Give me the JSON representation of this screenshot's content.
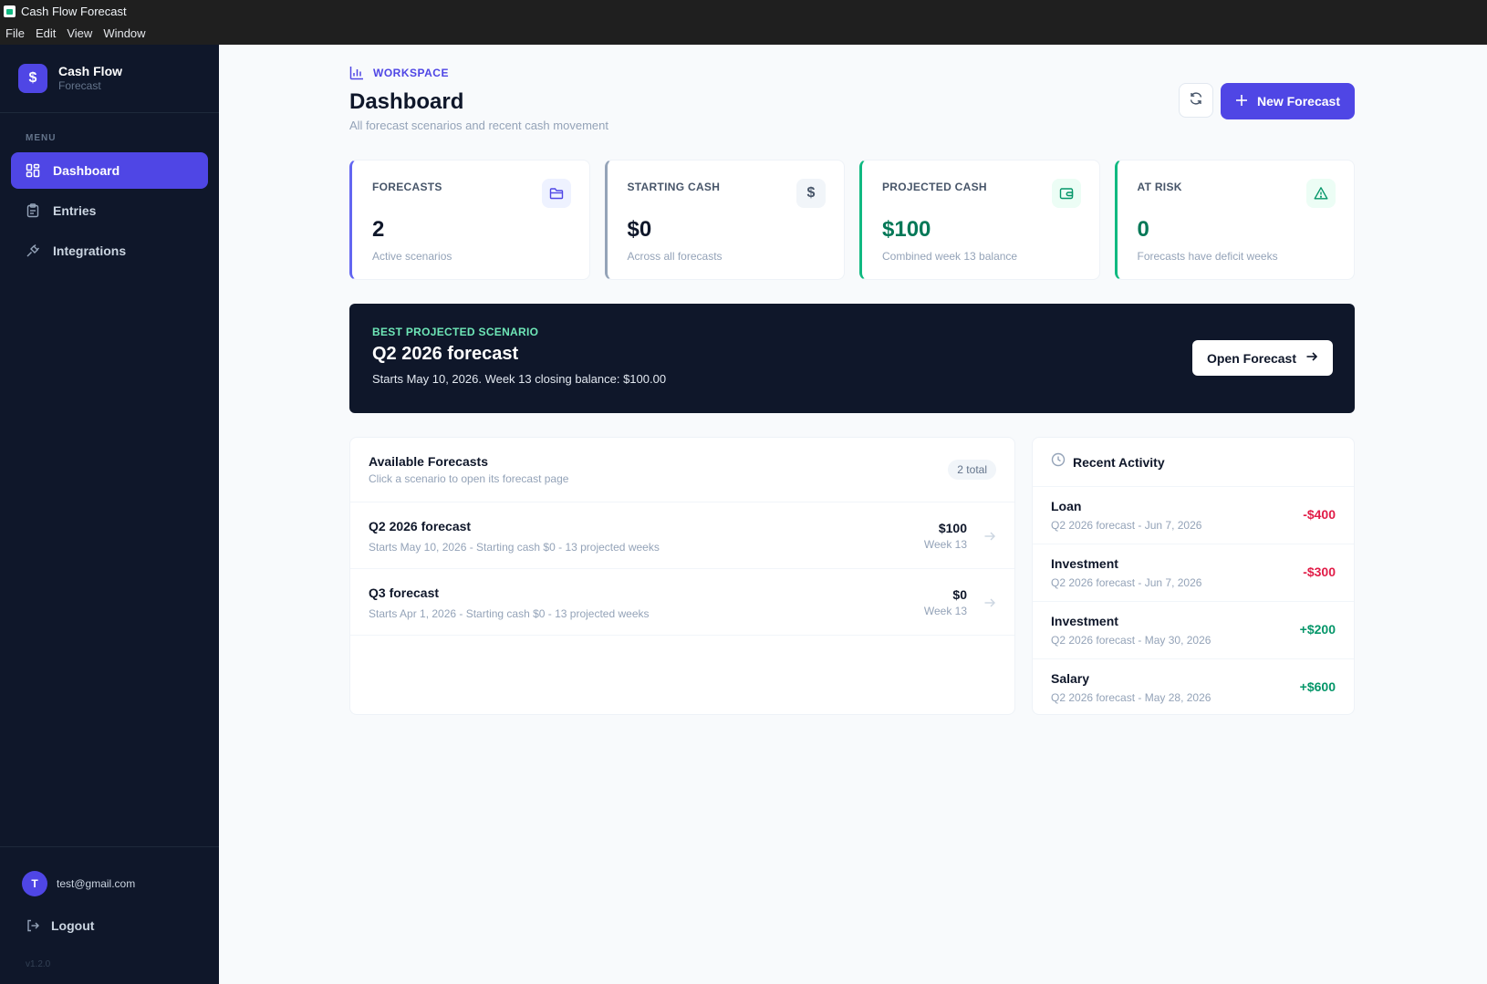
{
  "window": {
    "title": "Cash Flow Forecast"
  },
  "menubar": {
    "items": [
      "File",
      "Edit",
      "View",
      "Window"
    ]
  },
  "sidebar": {
    "brand_title": "Cash Flow",
    "brand_subtitle": "Forecast",
    "brand_icon": "dollar-icon",
    "menu_label": "MENU",
    "items": [
      {
        "label": "Dashboard",
        "icon": "dashboard-icon",
        "active": true
      },
      {
        "label": "Entries",
        "icon": "clipboard-icon",
        "active": false
      },
      {
        "label": "Integrations",
        "icon": "plug-icon",
        "active": false
      }
    ],
    "user": {
      "initial": "T",
      "email": "test@gmail.com"
    },
    "logout_label": "Logout",
    "version": "v1.2.0"
  },
  "header": {
    "eyebrow": "WORKSPACE",
    "title": "Dashboard",
    "subtitle": "All forecast scenarios and recent cash movement",
    "new_button": "New Forecast"
  },
  "stats": [
    {
      "label": "FORECASTS",
      "value": "2",
      "note": "Active scenarios",
      "icon": "folder-icon",
      "accent": "#6366f1"
    },
    {
      "label": "STARTING CASH",
      "value": "$0",
      "note": "Across all forecasts",
      "icon": "dollar-icon",
      "accent": "#94a3b8"
    },
    {
      "label": "PROJECTED CASH",
      "value": "$100",
      "note": "Combined week 13 balance",
      "icon": "wallet-icon",
      "accent": "#10b981"
    },
    {
      "label": "AT RISK",
      "value": "0",
      "note": "Forecasts have deficit weeks",
      "icon": "warning-icon",
      "accent": "#10b981"
    }
  ],
  "banner": {
    "eyebrow": "BEST PROJECTED SCENARIO",
    "title": "Q2 2026 forecast",
    "subtitle": "Starts May 10, 2026. Week 13 closing balance: $100.00",
    "button": "Open Forecast"
  },
  "forecasts": {
    "title": "Available Forecasts",
    "subtitle": "Click a scenario to open its forecast page",
    "count": "2 total",
    "rows": [
      {
        "name": "Q2 2026 forecast",
        "meta": "Starts May 10, 2026 - Starting cash $0 - 13 projected weeks",
        "amount": "$100",
        "week": "Week 13"
      },
      {
        "name": "Q3 forecast",
        "meta": "Starts Apr 1, 2026 - Starting cash $0 - 13 projected weeks",
        "amount": "$0",
        "week": "Week 13"
      }
    ]
  },
  "activity": {
    "title": "Recent Activity",
    "rows": [
      {
        "name": "Loan",
        "meta": "Q2 2026 forecast - Jun 7, 2026",
        "amount": "-$400",
        "sign": "neg"
      },
      {
        "name": "Investment",
        "meta": "Q2 2026 forecast - Jun 7, 2026",
        "amount": "-$300",
        "sign": "neg"
      },
      {
        "name": "Investment",
        "meta": "Q2 2026 forecast - May 30, 2026",
        "amount": "+$200",
        "sign": "pos"
      },
      {
        "name": "Salary",
        "meta": "Q2 2026 forecast - May 28, 2026",
        "amount": "+$600",
        "sign": "pos"
      }
    ]
  },
  "colors": {
    "accent": "#4f46e5",
    "sidebar": "#0f172a",
    "positive": "#059669",
    "negative": "#e11d48"
  }
}
